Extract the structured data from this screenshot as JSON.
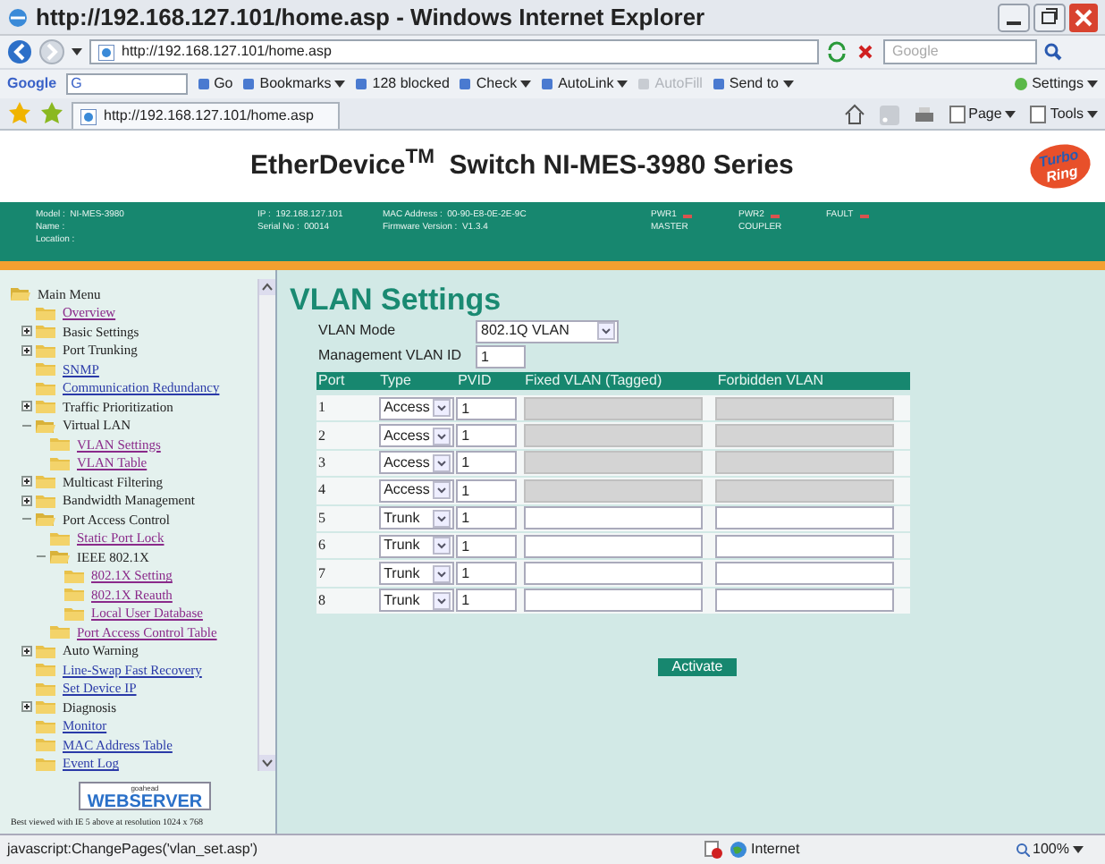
{
  "browser": {
    "title": "http://192.168.127.101/home.asp - Windows Internet Explorer",
    "address": "http://192.168.127.101/home.asp",
    "search_placeholder": "Google",
    "google_toolbar": [
      {
        "label": "Go",
        "has_menu": false,
        "disabled": false
      },
      {
        "label": "Bookmarks",
        "has_menu": true,
        "disabled": false
      },
      {
        "label": "128 blocked",
        "has_menu": false,
        "disabled": false
      },
      {
        "label": "Check",
        "has_menu": true,
        "disabled": false
      },
      {
        "label": "AutoLink",
        "has_menu": true,
        "disabled": false
      },
      {
        "label": "AutoFill",
        "has_menu": false,
        "disabled": true
      },
      {
        "label": "Send to",
        "has_menu": true,
        "disabled": false
      }
    ],
    "google_label": "Google",
    "google_field": "G",
    "settings": "Settings",
    "tab": "http://192.168.127.101/home.asp",
    "command_bar": [
      "Page",
      "Tools"
    ]
  },
  "header": {
    "title": "EtherDevice$^{TM}$  Switch NI-MES-3980 Series",
    "logo": [
      "Turbo",
      "Ring"
    ]
  },
  "info_band": {
    "columns": [
      [
        "Model :  NI-MES-3980",
        "Name :",
        "Location :"
      ],
      [
        "IP :  192.168.127.101",
        "Serial No :  00014"
      ],
      [
        "MAC Address :  00-90-E8-0E-2E-9C",
        "Firmware Version :  V1.3.4"
      ]
    ],
    "indicators": [
      {
        "label": "PWR1",
        "color": "#d9534f",
        "role": "MASTER"
      },
      {
        "label": "PWR2",
        "color": "#d9534f",
        "role": "COUPLER"
      },
      {
        "label": "FAULT",
        "color": "#d9534f"
      }
    ]
  },
  "menu": {
    "label": "Main Menu",
    "kind": "group",
    "expanded": true,
    "children": [
      {
        "label": "Overview",
        "kind": "link",
        "visited": true
      },
      {
        "label": "Basic Settings",
        "kind": "group",
        "expanded": false
      },
      {
        "label": "Port Trunking",
        "kind": "group",
        "expanded": false
      },
      {
        "label": "SNMP",
        "kind": "link",
        "visited": false
      },
      {
        "label": "Communication Redundancy",
        "kind": "link",
        "visited": false
      },
      {
        "label": "Traffic Prioritization",
        "kind": "group",
        "expanded": false
      },
      {
        "label": "Virtual LAN",
        "kind": "group",
        "expanded": true,
        "children": [
          {
            "label": "VLAN Settings",
            "kind": "link",
            "visited": true
          },
          {
            "label": "VLAN Table",
            "kind": "link",
            "visited": true
          }
        ]
      },
      {
        "label": "Multicast Filtering",
        "kind": "group",
        "expanded": false
      },
      {
        "label": "Bandwidth Management",
        "kind": "group",
        "expanded": false
      },
      {
        "label": "Port Access Control",
        "kind": "group",
        "expanded": true,
        "children": [
          {
            "label": "Static Port Lock",
            "kind": "link",
            "visited": true
          },
          {
            "label": "IEEE 802.1X",
            "kind": "group",
            "expanded": true,
            "children": [
              {
                "label": "802.1X Setting",
                "kind": "link",
                "visited": true
              },
              {
                "label": "802.1X Reauth",
                "kind": "link",
                "visited": true
              },
              {
                "label": "Local User Database",
                "kind": "link",
                "visited": true
              }
            ]
          },
          {
            "label": "Port Access Control Table",
            "kind": "link",
            "visited": true
          }
        ]
      },
      {
        "label": "Auto Warning",
        "kind": "group",
        "expanded": false
      },
      {
        "label": "Line-Swap Fast Recovery",
        "kind": "link",
        "visited": false
      },
      {
        "label": "Set Device IP",
        "kind": "link",
        "visited": false
      },
      {
        "label": "Diagnosis",
        "kind": "group",
        "expanded": false
      },
      {
        "label": "Monitor",
        "kind": "link",
        "visited": false
      },
      {
        "label": "MAC Address Table",
        "kind": "link",
        "visited": false
      },
      {
        "label": "Event Log",
        "kind": "link",
        "visited": false
      }
    ]
  },
  "webserver_logo": [
    "goahead",
    "WEBSERVER"
  ],
  "footer": "Best viewed with IE 5 above at resolution 1024 x 768",
  "vlan": {
    "title": "VLAN Settings",
    "mode_label": "VLAN Mode",
    "mode": "802.1Q VLAN",
    "mgmt_label": "Management VLAN ID",
    "mgmt_id": "1",
    "columns": [
      "Port",
      "Type",
      "PVID",
      "Fixed VLAN (Tagged)",
      "Forbidden VLAN"
    ],
    "rows": [
      {
        "port": "1",
        "type": "Access",
        "pvid": "1",
        "disabled": true
      },
      {
        "port": "2",
        "type": "Access",
        "pvid": "1",
        "disabled": true
      },
      {
        "port": "3",
        "type": "Access",
        "pvid": "1",
        "disabled": true
      },
      {
        "port": "4",
        "type": "Access",
        "pvid": "1",
        "disabled": true
      },
      {
        "port": "5",
        "type": "Trunk",
        "pvid": "1",
        "disabled": false
      },
      {
        "port": "6",
        "type": "Trunk",
        "pvid": "1",
        "disabled": false
      },
      {
        "port": "7",
        "type": "Trunk",
        "pvid": "1",
        "disabled": false
      },
      {
        "port": "8",
        "type": "Trunk",
        "pvid": "1",
        "disabled": false
      }
    ],
    "button": "Activate"
  },
  "status_bar": {
    "text": "javascript:ChangePages('vlan_set.asp')",
    "zone": "Internet",
    "zoom": "100%"
  }
}
